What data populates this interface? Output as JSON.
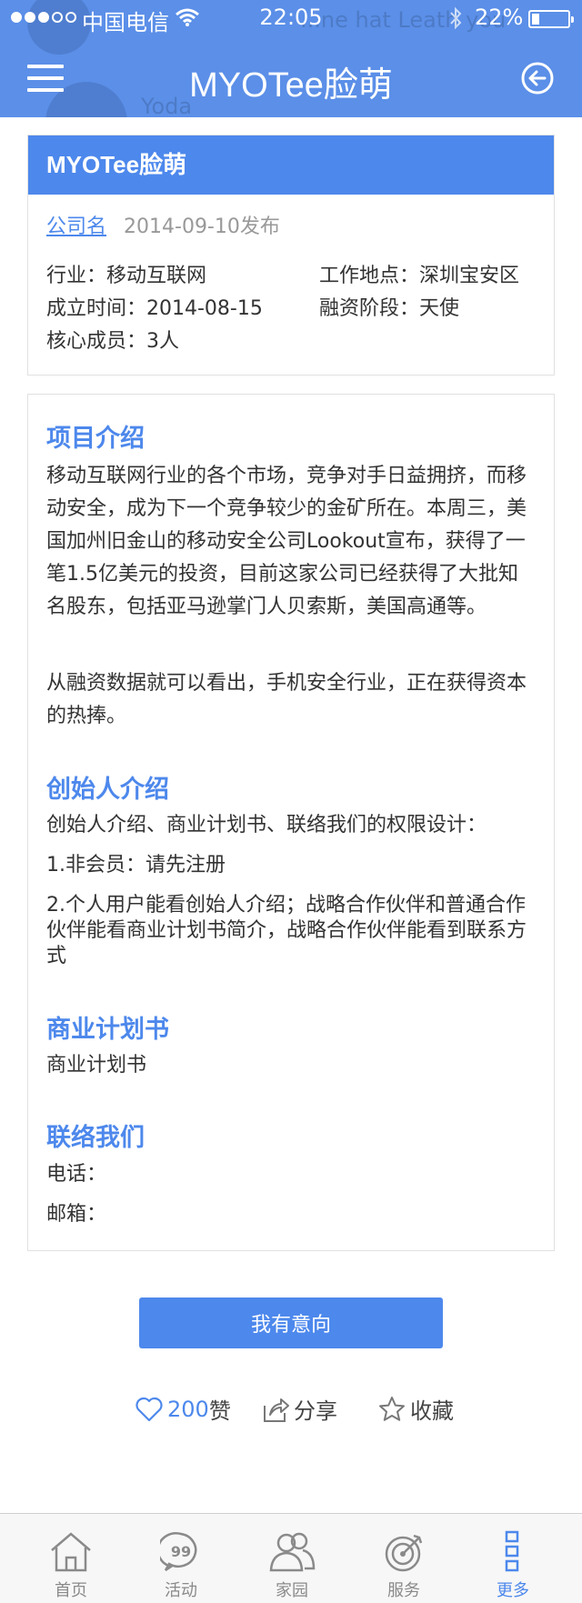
{
  "status_bar": {
    "carrier": "中国电信",
    "time": "22:05",
    "battery": "22%"
  },
  "header": {
    "title": "MYOTee脸萌",
    "ghost_text_1": "...ne hat Leath you",
    "ghost_text_2": "Yoda"
  },
  "company_card": {
    "name": "MYOTee脸萌",
    "company_link": "公司名",
    "publish_date": "2014-09-10发布",
    "industry": "行业：移动互联网",
    "location": "工作地点：深圳宝安区",
    "founded": "成立时间：2014-08-15",
    "funding_stage": "融资阶段：天使",
    "core_members": "核心成员：3人"
  },
  "detail": {
    "project_title": "项目介绍",
    "project_p1": "移动互联网行业的各个市场，竞争对手日益拥挤，而移动安全，成为下一个竞争较少的金矿所在。本周三，美国加州旧金山的移动安全公司Lookout宣布，获得了一笔1.5亿美元的投资，目前这家公司已经获得了大批知名股东，包括亚马逊掌门人贝索斯，美国高通等。",
    "project_p2": "从融资数据就可以看出，手机安全行业，正在获得资本的热捧。",
    "founder_title": "创始人介绍",
    "founder_p1": "创始人介绍、商业计划书、联络我们的权限设计：",
    "founder_p2": "1.非会员：请先注册",
    "founder_p3": "2.个人用户能看创始人介绍；战略合作伙伴和普通合作伙伴能看商业计划书简介，战略合作伙伴能看到联系方式",
    "plan_title": "商业计划书",
    "plan_p1": "商业计划书",
    "contact_title": "联络我们",
    "phone": "电话：",
    "email": "邮箱："
  },
  "intent_button": "我有意向",
  "actions": {
    "like_count": "200",
    "like_label": "赞",
    "share_label": "分享",
    "favorite_label": "收藏"
  },
  "tabs": [
    {
      "label": "首页",
      "icon": "home-icon"
    },
    {
      "label": "活动",
      "icon": "activity-icon"
    },
    {
      "label": "家园",
      "icon": "community-icon"
    },
    {
      "label": "服务",
      "icon": "service-icon"
    },
    {
      "label": "更多",
      "icon": "more-icon",
      "active": true
    }
  ],
  "colors": {
    "accent": "#4d88ec",
    "header_bg": "#5b8fe8"
  }
}
